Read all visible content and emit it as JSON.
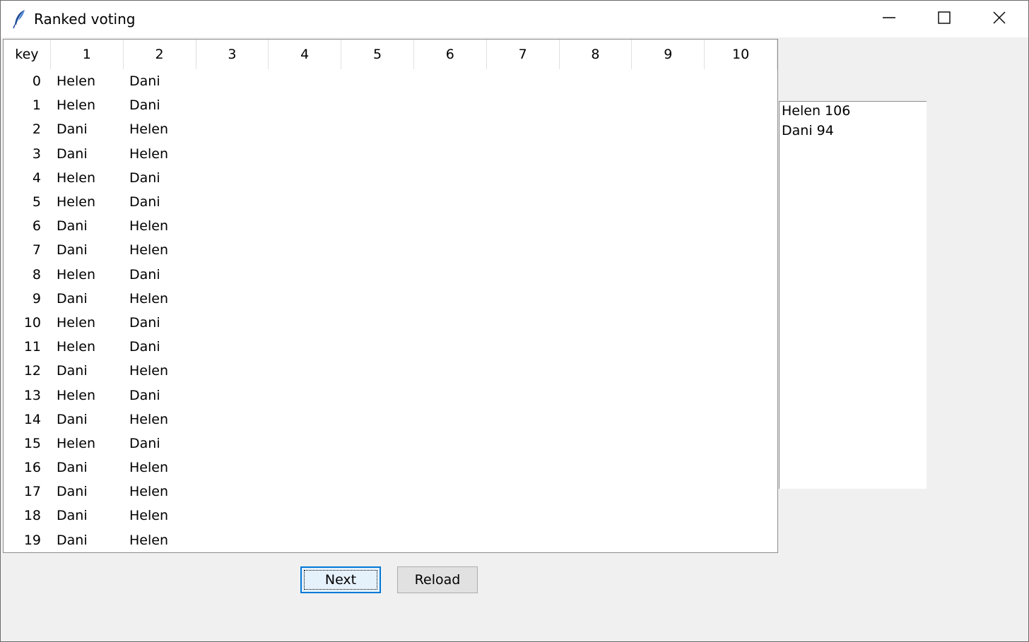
{
  "window": {
    "title": "Ranked voting"
  },
  "table": {
    "headers": [
      "key",
      "1",
      "2",
      "3",
      "4",
      "5",
      "6",
      "7",
      "8",
      "9",
      "10"
    ],
    "rows": [
      [
        "0",
        "Helen",
        "Dani"
      ],
      [
        "1",
        "Helen",
        "Dani"
      ],
      [
        "2",
        "Dani",
        "Helen"
      ],
      [
        "3",
        "Dani",
        "Helen"
      ],
      [
        "4",
        "Helen",
        "Dani"
      ],
      [
        "5",
        "Helen",
        "Dani"
      ],
      [
        "6",
        "Dani",
        "Helen"
      ],
      [
        "7",
        "Dani",
        "Helen"
      ],
      [
        "8",
        "Helen",
        "Dani"
      ],
      [
        "9",
        "Dani",
        "Helen"
      ],
      [
        "10",
        "Helen",
        "Dani"
      ],
      [
        "11",
        "Helen",
        "Dani"
      ],
      [
        "12",
        "Dani",
        "Helen"
      ],
      [
        "13",
        "Helen",
        "Dani"
      ],
      [
        "14",
        "Dani",
        "Helen"
      ],
      [
        "15",
        "Helen",
        "Dani"
      ],
      [
        "16",
        "Dani",
        "Helen"
      ],
      [
        "17",
        "Dani",
        "Helen"
      ],
      [
        "18",
        "Dani",
        "Helen"
      ],
      [
        "19",
        "Dani",
        "Helen"
      ]
    ]
  },
  "results": {
    "lines": [
      "Helen 106",
      "Dani 94"
    ]
  },
  "buttons": {
    "next_label": "Next",
    "reload_label": "Reload"
  },
  "icons": {
    "app": "feather-icon",
    "minimize": "minimize-icon",
    "maximize": "maximize-icon",
    "close": "close-icon"
  },
  "colors": {
    "window_bg": "#f0f0f0",
    "focus_border": "#0078d7"
  }
}
